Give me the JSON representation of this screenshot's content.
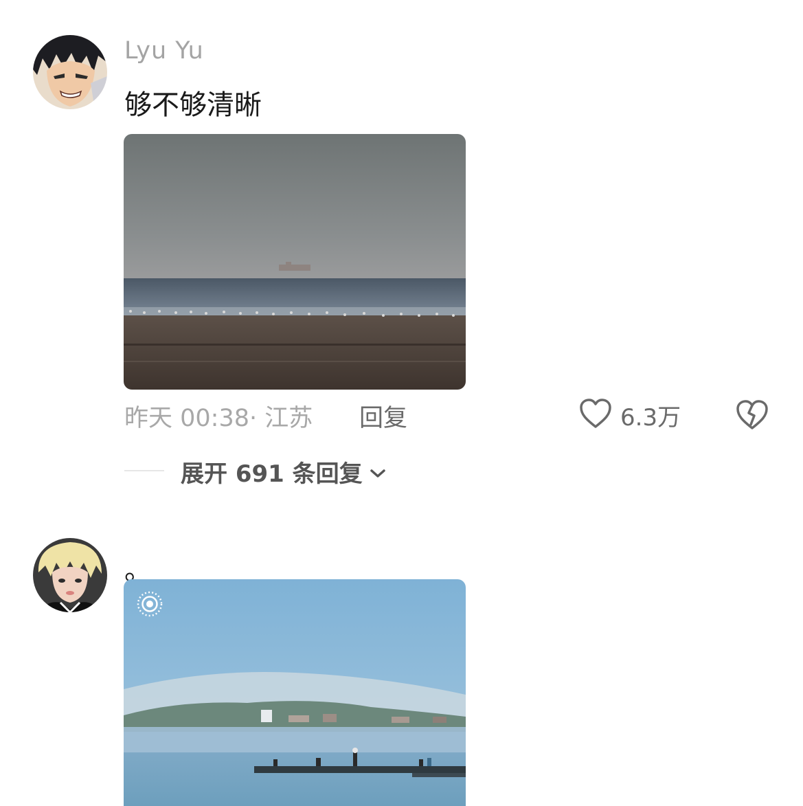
{
  "comments": [
    {
      "username": "Lyu Yu",
      "text": "够不够清晰",
      "timestamp": "昨天 00:38· 江苏",
      "reply_label": "回复",
      "likes": "6.3万",
      "expand_label": "展开 691 条回复"
    },
    {
      "username": "",
      "text": "。"
    }
  ],
  "icons": {
    "like": "heart-outline-icon",
    "dislike": "broken-heart-icon",
    "expand": "chevron-down-icon",
    "live_photo": "live-photo-icon"
  },
  "colors": {
    "secondary_text": "#a8a8a8",
    "action_text": "#6a6a6a",
    "primary_text": "#1a1a1a"
  }
}
